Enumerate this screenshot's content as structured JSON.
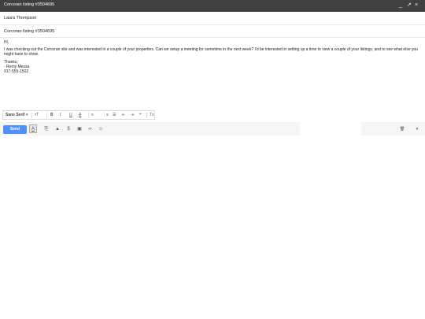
{
  "window": {
    "title": "Corcoran listing #3504695",
    "minimize_glyph": "_",
    "popout_glyph": "↗",
    "close_glyph": "×"
  },
  "compose": {
    "to": "Laura Thompson",
    "subject": "Corcoran listing #3504695",
    "body": {
      "greeting": "Hi,",
      "paragraph": "I was checking out the Corcoran site and was interested in a couple of your properties. Can we setup a meeting for sometime in the next week? I'd be interested in setting up a time to view a couple of your listings, and to see what else you might have to show.",
      "closing": "Thanks,",
      "name": "- Remy Messa",
      "phone": "917-555-1502"
    }
  },
  "format_toolbar": {
    "font_label": "Sans Serif",
    "font_dropdown_glyph": "▾",
    "size_glyph": "ᴛT",
    "bold_glyph": "B",
    "italic_glyph": "I",
    "underline_glyph": "U",
    "text_color_glyph": "A",
    "align_glyph": "≡",
    "numbered_list_glyph": "⋮≡",
    "bulleted_list_glyph": "☰",
    "indent_less_glyph": "⇤",
    "indent_more_glyph": "⇥",
    "quote_glyph": "❝",
    "remove_format_glyph": "Tx"
  },
  "bottom_toolbar": {
    "send_label": "Send",
    "format_glyph": "A",
    "attach_glyph": "⎘",
    "drive_glyph": "▲",
    "money_glyph": "$",
    "photo_glyph": "▣",
    "link_glyph": "∞",
    "emoji_glyph": "☺",
    "trash_glyph": "🗑",
    "more_glyph": "▾"
  }
}
